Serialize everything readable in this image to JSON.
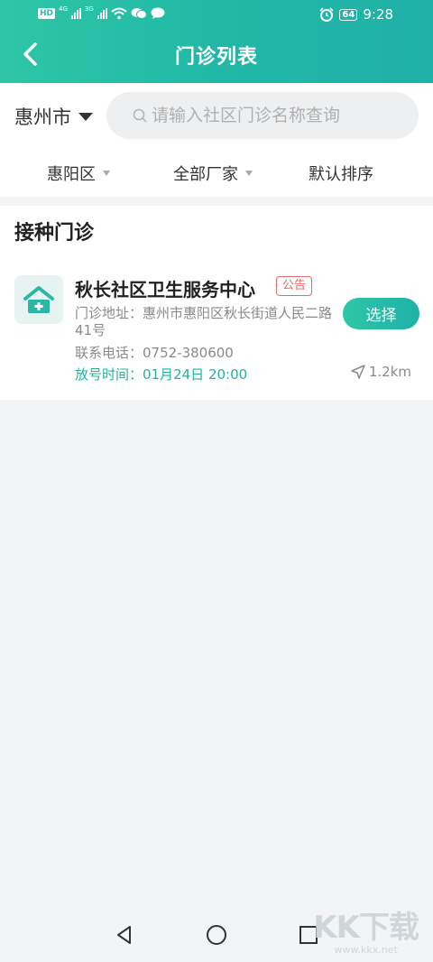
{
  "status_bar": {
    "hd": "HD",
    "net1": "4G",
    "net2": "3G",
    "battery": "64",
    "time": "9:28"
  },
  "header": {
    "title": "门诊列表"
  },
  "search": {
    "city": "惠州市",
    "placeholder": "请输入社区门诊名称查询"
  },
  "filters": [
    {
      "label": "惠阳区"
    },
    {
      "label": "全部厂家"
    },
    {
      "label": "默认排序"
    }
  ],
  "section": {
    "title": "接种门诊",
    "clinic": {
      "name": "秋长社区卫生服务中心",
      "notice": "公告",
      "address": "门诊地址：惠州市惠阳区秋长街道人民二路41号",
      "phone": "联系电话：0752-380600",
      "time": "放号时间：01月24日 20:00",
      "distance": "1.2km",
      "select_label": "选择"
    }
  },
  "watermark": {
    "brand": "KK下载",
    "url": "www.kkx.net"
  },
  "colors": {
    "primary": "#21b8a7",
    "notice": "#e26a6a"
  }
}
